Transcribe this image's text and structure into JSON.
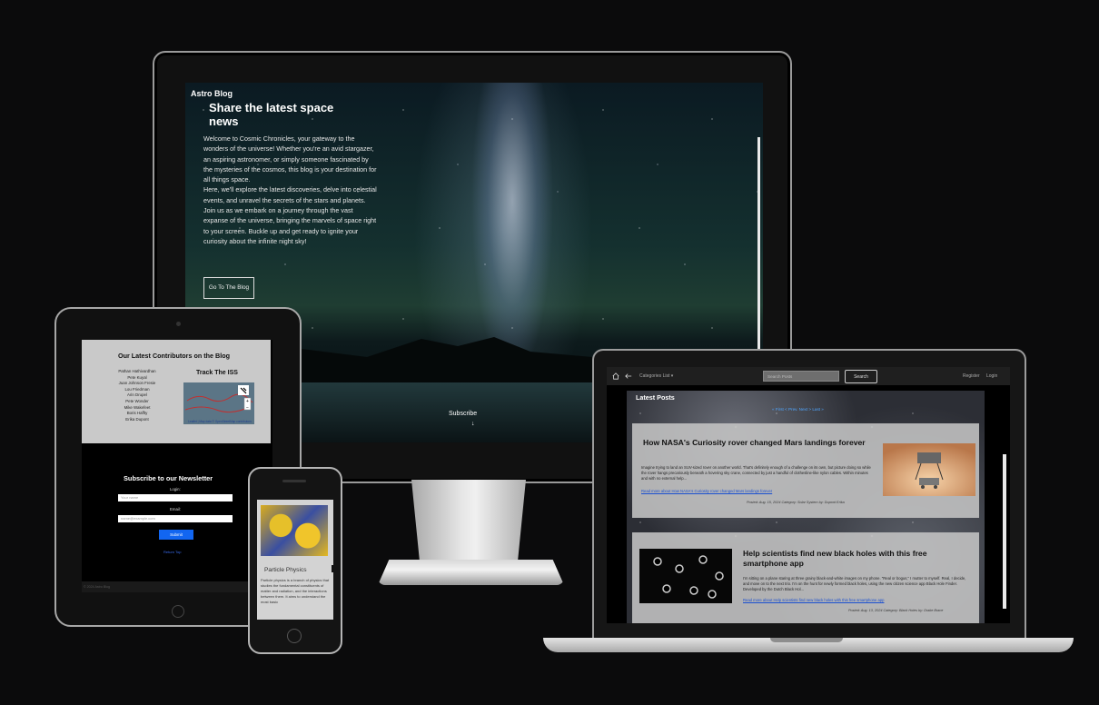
{
  "desktop": {
    "brand": "Astro Blog",
    "hero_title": "Share the latest space news",
    "hero_text": "Welcome to Cosmic Chronicles, your gateway to the wonders of the universe! Whether you're an avid stargazer, an aspiring astronomer, or simply someone fascinated by the mysteries of the cosmos, this blog is your destination for all things space.",
    "hero_text2": "Here, we'll explore the latest discoveries, delve into celestial events, and unravel the secrets of the stars and planets. Join us as we embark on a journey through the vast expanse of the universe, bringing the marvels of space right to your screen. Buckle up and get ready to ignite your curiosity about the infinite night sky!",
    "cta_button": "Go To The Blog",
    "subscribe": "Subscribe",
    "subscribe_arrow": "↓"
  },
  "tablet": {
    "contributors_title": "Our Latest Contributors on the Blog",
    "contributors": [
      "Pathan Hathivardhan",
      "Pete Kuyal",
      "Juan Johnson Fresie",
      "Lou Friedman",
      "Arin Drupel",
      "Pete Wonder",
      "Mike Wakefeet",
      "Boris Haffty",
      "Erika Dupont"
    ],
    "iss_title": "Track The ISS",
    "map_attribution": "Leaflet | Map data © OpenStreetMap contributors",
    "newsletter_title": "Subscribe to our Newsletter",
    "login_label": "Login:",
    "login_placeholder": "Your name",
    "email_label": "Email:",
    "email_placeholder": "name@example.com",
    "submit": "Submit",
    "return": "Return Top",
    "footer": "© 2024 Astro Blog"
  },
  "phone": {
    "post_title": "Particle Physics",
    "post_text": "Particle physics is a branch of physics that studies the fundamental constituents of matter and radiation, and the interactions between them. It aims to understand the most basic"
  },
  "laptop": {
    "nav": {
      "home_icon": "home-icon",
      "back_icon": "back-arrow-icon",
      "categories": "Categories List",
      "categories_caret": "▾",
      "search_placeholder": "Search Posts",
      "search_button": "Search",
      "register": "Register",
      "login": "Login"
    },
    "latest_title": "Latest Posts",
    "pager": "« First < Prev. Next > Last »",
    "posts": [
      {
        "title": "How NASA's Curiosity rover changed Mars landings forever",
        "body": "Imagine trying to land an SUV-sized rover on another world. That's definitely enough of a challenge on its own, but picture doing so while the rover hangs precariously beneath a hovering sky crane, connected by just a handful of clothesline-like nylon cables. Within minutes and with no external help...",
        "link": "Read more about How NASA's Curiosity rover changed Mars landings forever",
        "meta": "Posted: Aug. 15, 2024 Category: Solar System by: Dupont Erika"
      },
      {
        "title": "Help scientists find new black holes with this free smartphone app",
        "body": "I'm sitting on a plane staring at three grainy black-and-white images on my phone. \"Real or bogus,\" I mutter to myself. Real, I decide, and move on to the next trio. I'm on the hunt for newly formed black holes, using the new citizen science app Black Hole Finder. Developed by the Dutch Black Hol...",
        "link": "Read more about Help scientists find new black holes with this free smartphone app",
        "meta": "Posted: Aug. 13, 2024 Category: Black Holes by: Drake Brace"
      }
    ]
  }
}
